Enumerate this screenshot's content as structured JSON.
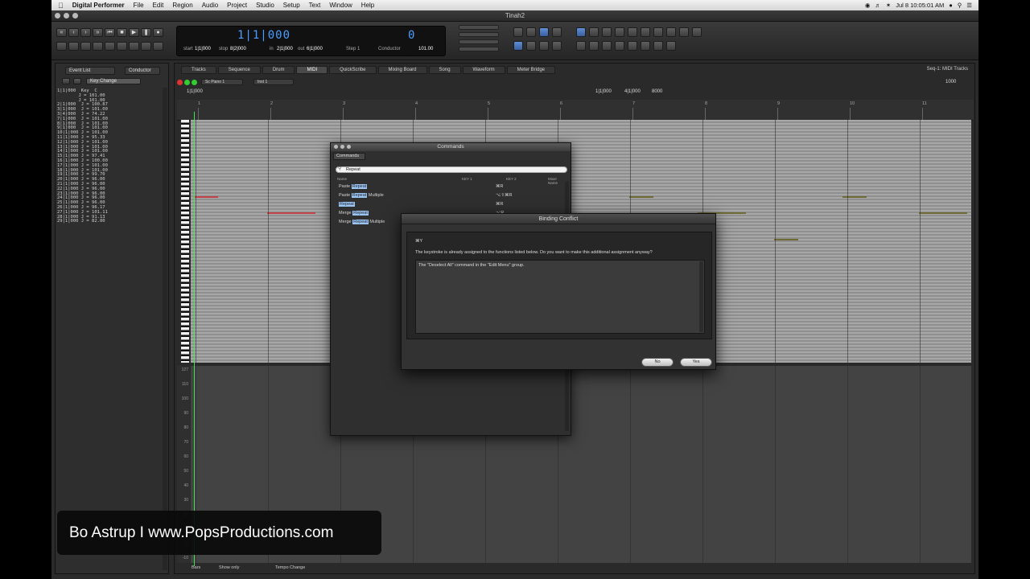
{
  "menubar": {
    "apple": "",
    "app_name": "Digital Performer",
    "items": [
      "File",
      "Edit",
      "Region",
      "Audio",
      "Project",
      "Studio",
      "Setup",
      "Text",
      "Window",
      "Help"
    ],
    "clock": "Jul 8  10:05:01 AM"
  },
  "window": {
    "title": "Tinah2"
  },
  "toolbar": {
    "counter": "1|1|000",
    "counter_right": "0",
    "start_label": "start",
    "start_value": "1|1|000",
    "stop_label": "stop",
    "stop_value": "8|2|000",
    "in_label": "in",
    "in_value": "2|1|000",
    "out_label": "out",
    "out_value": "6|1|000",
    "step_label": "Step 1",
    "conductor_label": "Conductor",
    "tempo_value": "101.00"
  },
  "left_panel": {
    "tab1": "Event List",
    "tab2": "Conductor",
    "filter": "Key Change",
    "events": [
      "1|1|000  Key  C",
      "        J = 101.00",
      "        J = 101.00",
      "2|1|000  J = 100.87",
      "3|1|000  J = 101.00",
      "3|4|000  J = 74.22",
      "7|1|000  J = 101.00",
      "8|1|000  J = 101.00",
      "9|1|000  J = 101.00",
      "10|1|000 J = 101.00",
      "11|1|000 J = 95.33",
      "12|1|000 J = 101.00",
      "13|1|000 J = 101.00",
      "14|1|000 J = 101.00",
      "15|1|000 J = 97.41",
      "16|1|000 J = 100.00",
      "17|1|000 J = 101.00",
      "18|1|000 J = 101.00",
      "19|1|000 J = 99.70",
      "20|1|000 J = 96.00",
      "21|1|000 J = 96.00",
      "22|1|000 J = 96.00",
      "23|1|000 J = 96.00",
      "24|1|000 J = 96.00",
      "25|1|000 J = 96.00",
      "26|1|000 J = 96.17",
      "27|1|000 J = 101.11",
      "28|1|000 J = 91.13",
      "29|1|000 J = 82.00"
    ]
  },
  "tabs": [
    "Tracks",
    "Sequence",
    "Drum",
    "MIDI",
    "QuickScribe",
    "Mixing Board",
    "Song",
    "Waveform",
    "Meter Bridge"
  ],
  "active_tab": "MIDI",
  "sequence_label": "Seq-1: MIDI Tracks",
  "ruler_marks": [
    "1",
    "2",
    "3",
    "4",
    "5",
    "6",
    "7",
    "8",
    "9",
    "10",
    "11"
  ],
  "main_ctrl": {
    "track": "Sc Piano 1",
    "channel": "Inst 1",
    "start": "1|1|000",
    "mid1": "1|1|000",
    "mid2": "4|1|000",
    "mid3": "8000",
    "zoom": "1000"
  },
  "velocity_axis": [
    "127",
    "110",
    "100",
    "90",
    "80",
    "70",
    "60",
    "50",
    "40",
    "30",
    "20",
    "10",
    "0",
    "-10"
  ],
  "bottom_bar": {
    "item1": "Bars",
    "item2": "Show only",
    "item3": "Tempo Change"
  },
  "commands": {
    "title": "Commands",
    "tab": "Commands",
    "search_value": "Repeat",
    "headers": [
      "Name",
      "KEY 1",
      "KEY 2",
      "Mixer Name"
    ],
    "rows": [
      {
        "prefix": "Paste ",
        "hl": "Repeat",
        "suffix": "",
        "key": "⌘R"
      },
      {
        "prefix": "Paste ",
        "hl": "Repeat",
        "suffix": " Multiple",
        "key": "⌥⇧⌘R"
      },
      {
        "prefix": "",
        "hl": "Repeat",
        "suffix": "",
        "key": "⌘R"
      },
      {
        "prefix": "Merge ",
        "hl": "Repeat",
        "suffix": "",
        "key": "⌥R"
      },
      {
        "prefix": "Merge ",
        "hl": "Repeat",
        "suffix": " Multiple",
        "key": ""
      }
    ]
  },
  "conflict": {
    "title": "Binding Conflict",
    "key": "⌘Y",
    "message": "The keystroke is already assigned to the functions listed below.  Do you want to make this additional assignment anyway?",
    "detail": "The \"Deselect All\" command in the \"Edit Menu\" group.",
    "no_label": "No",
    "yes_label": "Yes"
  },
  "watermark": "Bo Astrup I www.PopsProductions.com",
  "colors": {
    "counter": "#4b9eff",
    "playhead": "#3fe04f",
    "note_red": "#c2424a",
    "note_olive": "#6f6b35",
    "highlight": "#9bc6f1"
  }
}
